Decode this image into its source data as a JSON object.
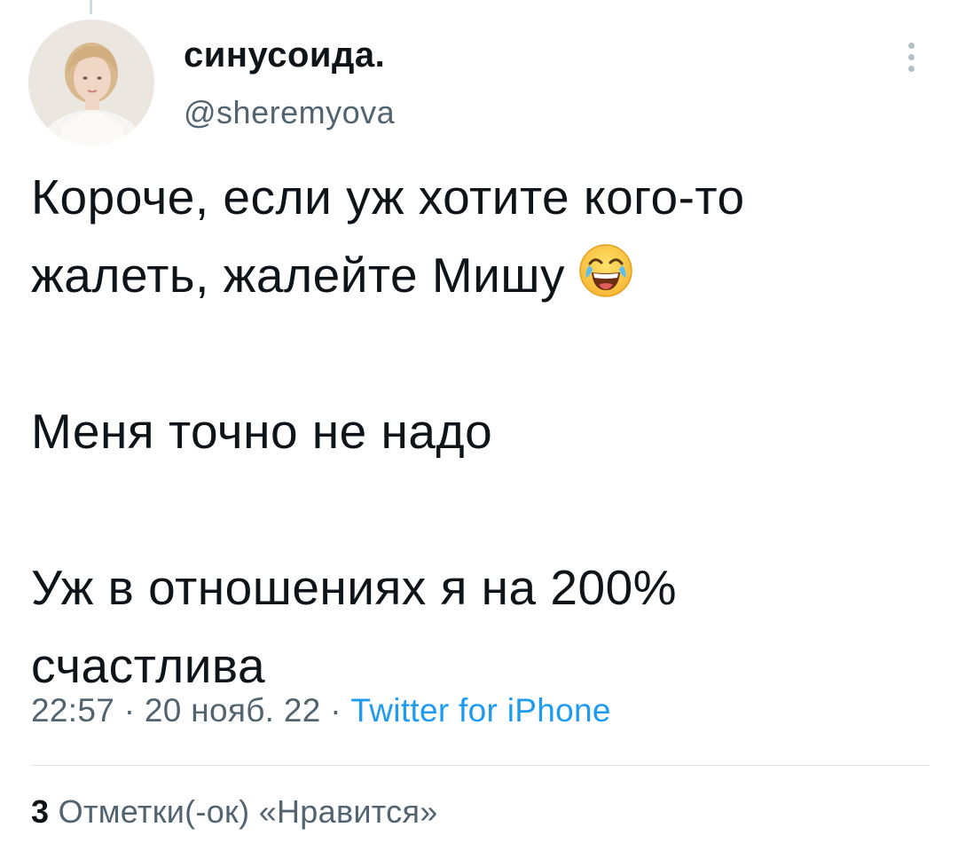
{
  "author": {
    "display_name": "синусоида.",
    "handle": "@sheremyova"
  },
  "tweet": {
    "lines": [
      "Короче, если уж хотите кого-то",
      "жалеть, жалейте Мишу",
      "",
      "Меня точно не надо",
      "",
      "Уж в отношениях я на 200%",
      "счастлива"
    ],
    "emoji": "face-with-tears-of-joy-icon"
  },
  "meta": {
    "time": "22:57",
    "separator": "·",
    "date": "20 нояб. 22",
    "source": "Twitter for iPhone"
  },
  "stats": {
    "likes_count": "3",
    "likes_label": "Отметки(-ок) «Нравится»"
  },
  "colors": {
    "text_primary": "#0f1419",
    "text_secondary": "#536471",
    "link": "#1d9bf0",
    "divider": "#dfe4e8"
  }
}
